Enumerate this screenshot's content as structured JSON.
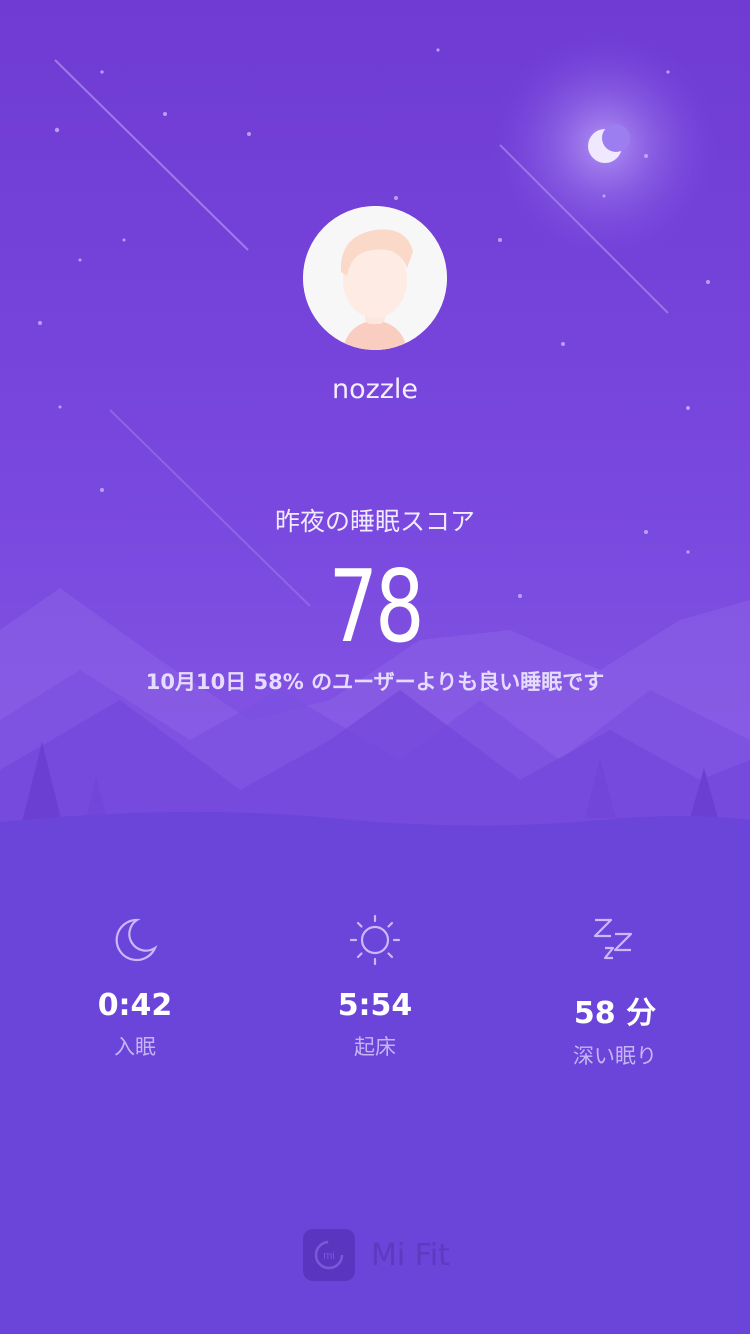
{
  "profile": {
    "username": "nozzle"
  },
  "sleep": {
    "score_label": "昨夜の睡眠スコア",
    "score": "78",
    "comparison": "10月10日 58% のユーザーよりも良い睡眠です"
  },
  "stats": [
    {
      "icon": "moon-icon",
      "value": "0:42",
      "label": "入眠"
    },
    {
      "icon": "sun-icon",
      "value": "5:54",
      "label": "起床"
    },
    {
      "icon": "zzz-icon",
      "value": "58 分",
      "label": "深い眠り"
    }
  ],
  "footer": {
    "brand": "Mi Fit",
    "logo_text": "mi"
  }
}
